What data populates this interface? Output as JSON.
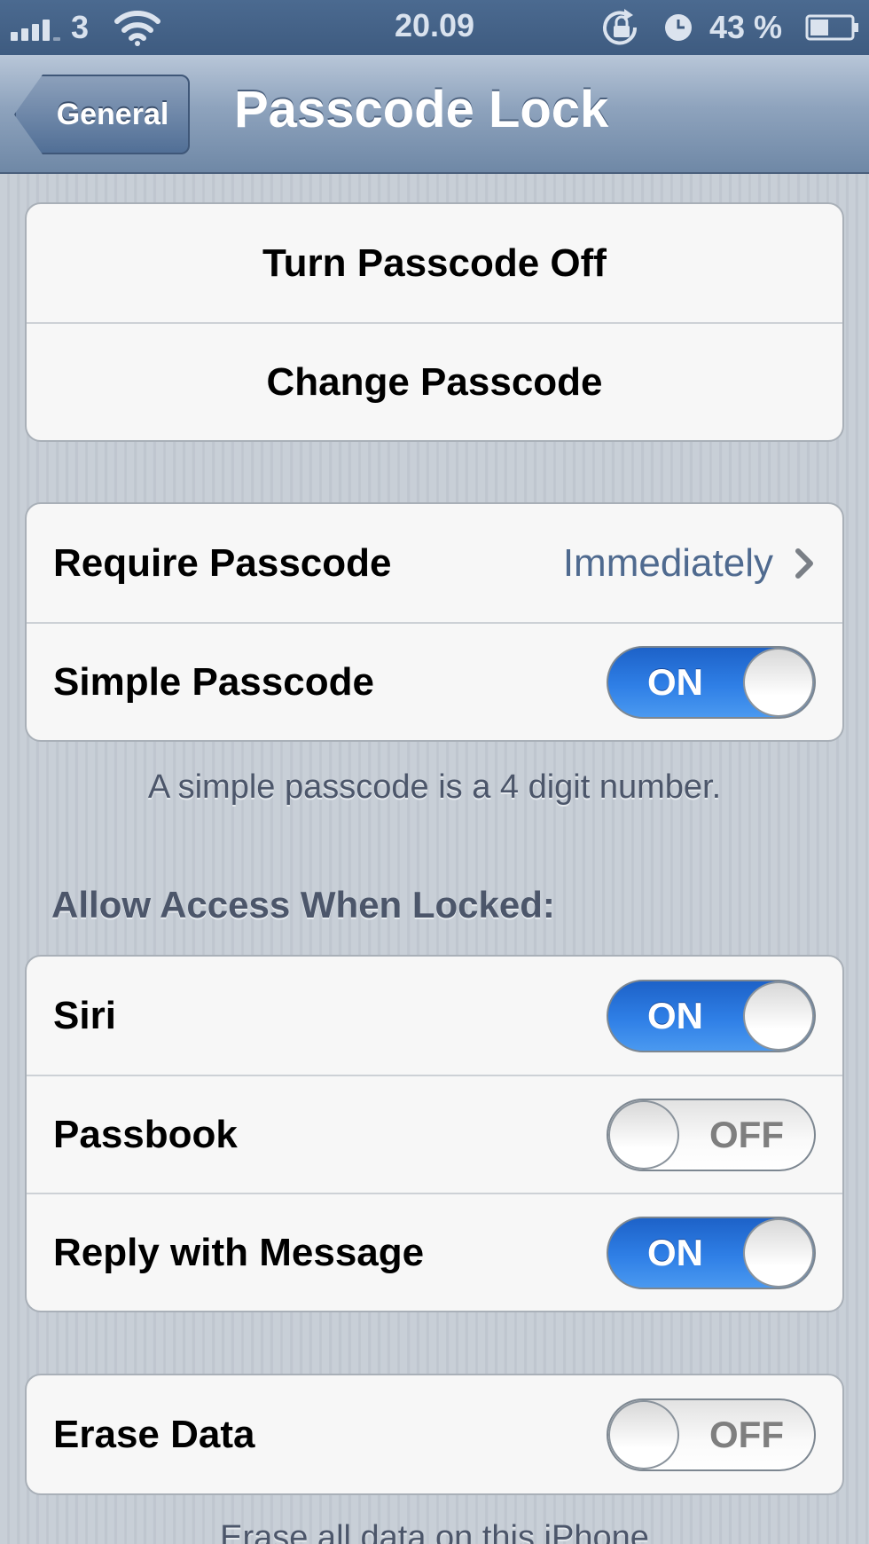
{
  "status_bar": {
    "carrier": "3",
    "time": "20.09",
    "battery": "43 %",
    "icons": [
      "signal-bars-icon",
      "wifi-icon",
      "rotation-lock-icon",
      "alarm-icon",
      "battery-icon"
    ]
  },
  "nav": {
    "back_label": "General",
    "title": "Passcode Lock"
  },
  "group1": {
    "turn_off": "Turn Passcode Off",
    "change": "Change Passcode"
  },
  "group2": {
    "require_label": "Require Passcode",
    "require_value": "Immediately",
    "simple_label": "Simple Passcode",
    "simple_state": "ON",
    "footnote": "A simple passcode is a 4 digit number."
  },
  "access": {
    "header": "Allow Access When Locked:",
    "siri_label": "Siri",
    "siri_state": "ON",
    "passbook_label": "Passbook",
    "passbook_state": "OFF",
    "reply_label": "Reply with Message",
    "reply_state": "ON"
  },
  "erase": {
    "label": "Erase Data",
    "state": "OFF",
    "footnote": "Erase all data on this iPhone"
  },
  "colors": {
    "toggle_on": "#2f7fe6",
    "value_text": "#4f6a8f",
    "nav_bar": "#8ea3bd"
  }
}
